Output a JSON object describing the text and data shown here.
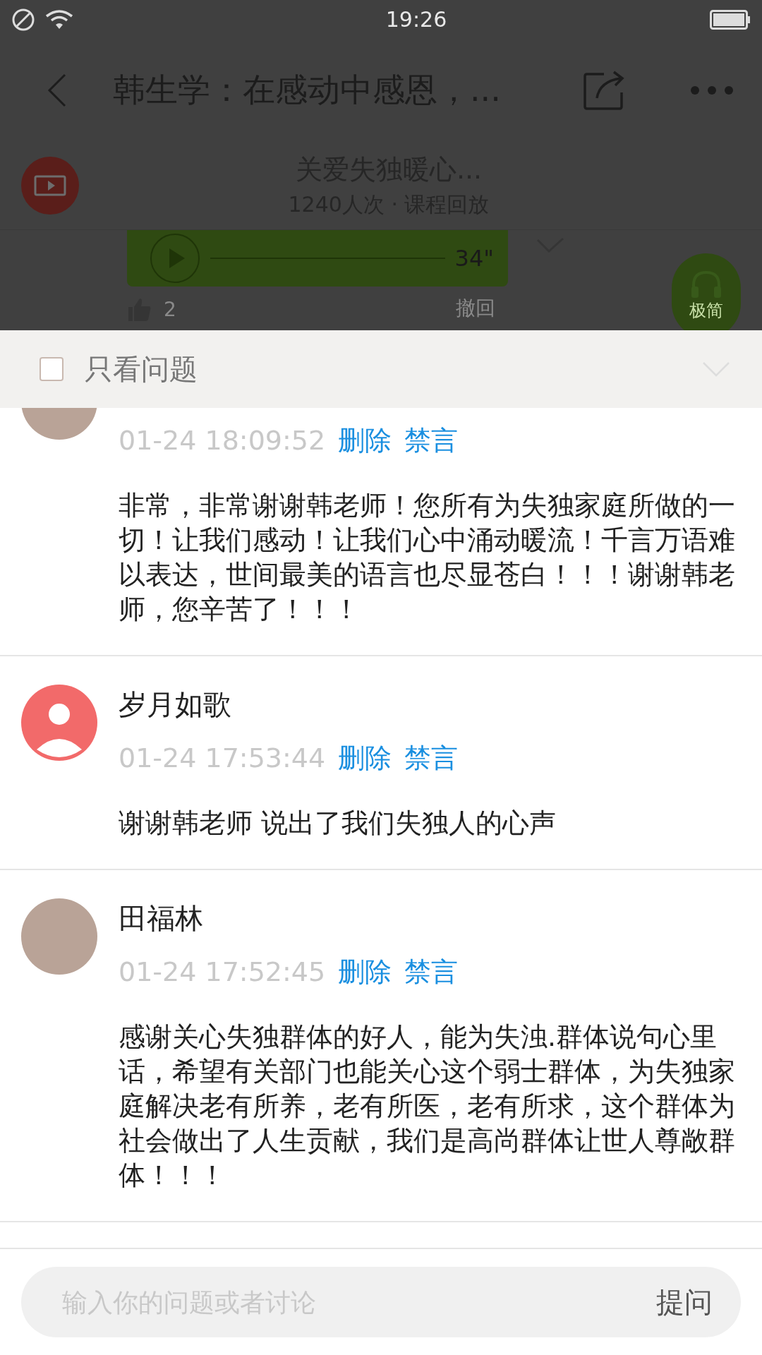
{
  "status_bar": {
    "time": "19:26"
  },
  "header": {
    "title": "韩生学：在感动中感恩，..."
  },
  "channel": {
    "name": "关爱失独暖心...",
    "meta": "1240人次 · 课程回放"
  },
  "voice_message": {
    "duration": "34\"",
    "likes": "2",
    "recall": "撤回",
    "mode_button": "极简"
  },
  "filter": {
    "label": "只看问题",
    "checked": false
  },
  "comments": [
    {
      "avatar": {
        "kind": "photo"
      },
      "time": "01-24 18:09:52",
      "actions": [
        "删除",
        "禁言"
      ],
      "text": "非常，非常谢谢韩老师！您所有为失独家庭所做的一切！让我们感动！让我们心中涌动暖流！千言万语难以表达，世间最美的语言也尽显苍白！！！谢谢韩老师，您辛苦了！！！"
    },
    {
      "avatar": {
        "kind": "default"
      },
      "name": "岁月如歌",
      "time": "01-24 17:53:44",
      "actions": [
        "删除",
        "禁言"
      ],
      "text": "谢谢韩老师 说出了我们失独人的心声"
    },
    {
      "avatar": {
        "kind": "photo"
      },
      "name": "田福林",
      "time": "01-24 17:52:45",
      "actions": [
        "删除",
        "禁言"
      ],
      "text": "感谢关心失独群体的好人，能为失浊.群体说句心里话，希望有关部门也能关心这个弱士群体，为失独家庭解决老有所养，老有所医，老有所求，这个群体为社会做出了人生贡献，我们是高尚群体让世人尊敞群体！！！"
    }
  ],
  "input": {
    "placeholder": "输入你的问题或者讨论",
    "button": "提问"
  }
}
